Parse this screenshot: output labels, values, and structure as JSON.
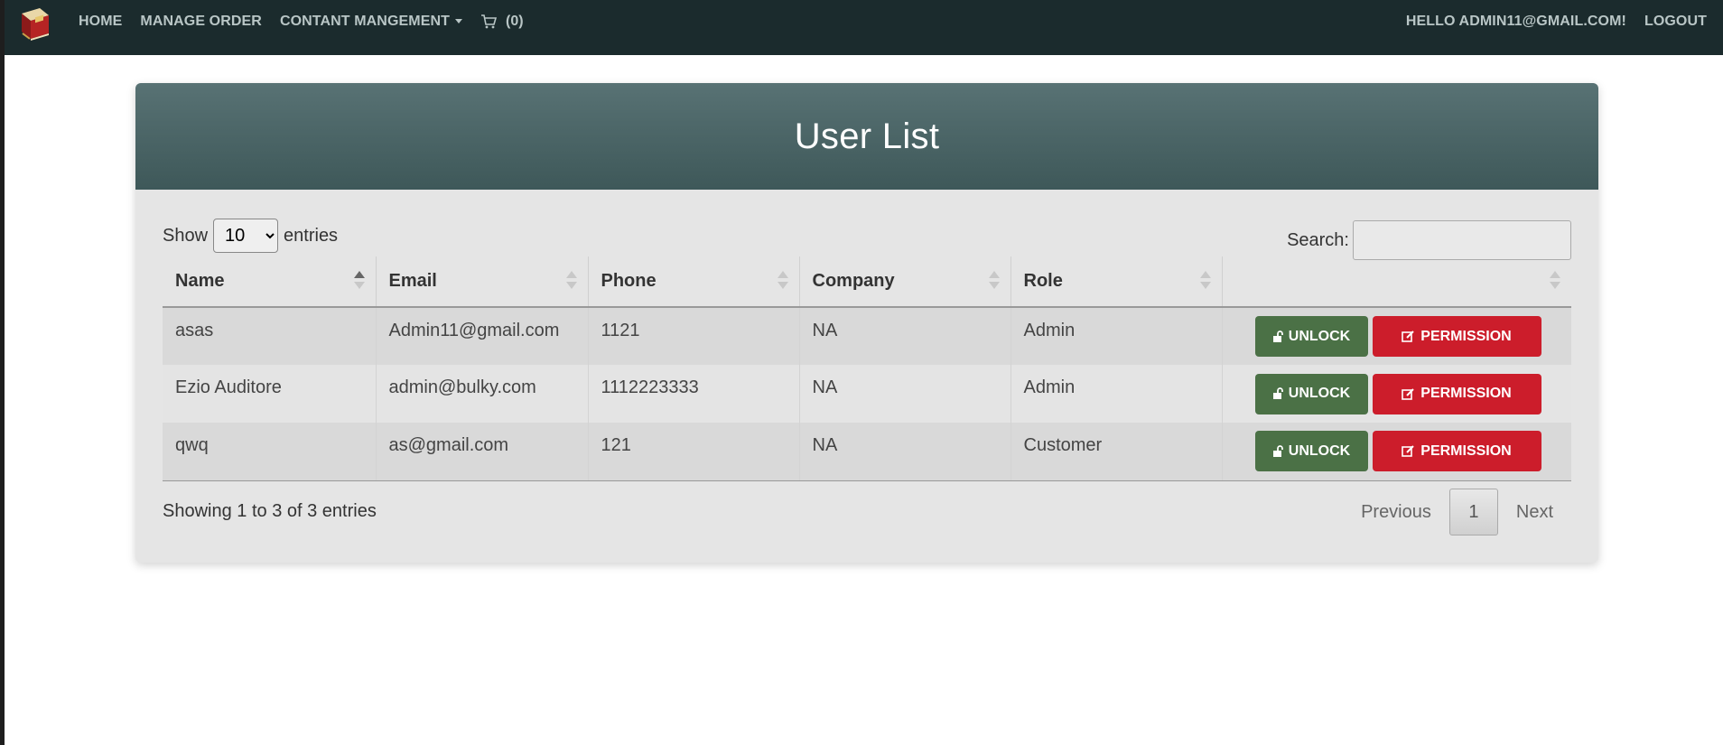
{
  "navbar": {
    "brand_icon": "book-logo-icon",
    "links": {
      "home": "HOME",
      "manage_order": "MANAGE ORDER",
      "content_management": "CONTANT MANGEMENT"
    },
    "cart_icon": "cart-icon",
    "cart_count": "(0)",
    "greeting": "HELLO ADMIN11@GMAIL.COM!",
    "logout": "LOGOUT"
  },
  "card": {
    "title": "User List",
    "length": {
      "show": "Show",
      "selected": "10",
      "entries": "entries"
    },
    "search": {
      "label": "Search:",
      "value": ""
    },
    "table": {
      "headers": [
        "Name",
        "Email",
        "Phone",
        "Company",
        "Role",
        ""
      ],
      "rows": [
        {
          "name": "asas",
          "email": "Admin11@gmail.com",
          "phone": "1121",
          "company": "NA",
          "role": "Admin"
        },
        {
          "name": "Ezio Auditore",
          "email": "admin@bulky.com",
          "phone": "1112223333",
          "company": "NA",
          "role": "Admin"
        },
        {
          "name": "qwq",
          "email": "as@gmail.com",
          "phone": "121",
          "company": "NA",
          "role": "Customer"
        }
      ],
      "unlock_label": "UNLOCK",
      "permission_label": "PERMISSION"
    },
    "info": "Showing 1 to 3 of 3 entries",
    "pagination": {
      "previous": "Previous",
      "current": "1",
      "next": "Next"
    }
  },
  "colors": {
    "navbar": "#1b2b2d",
    "header_top": "#587274",
    "header_bottom": "#3e5859",
    "unlock_button": "#4b7146",
    "permission_button": "#cc1d2b"
  }
}
